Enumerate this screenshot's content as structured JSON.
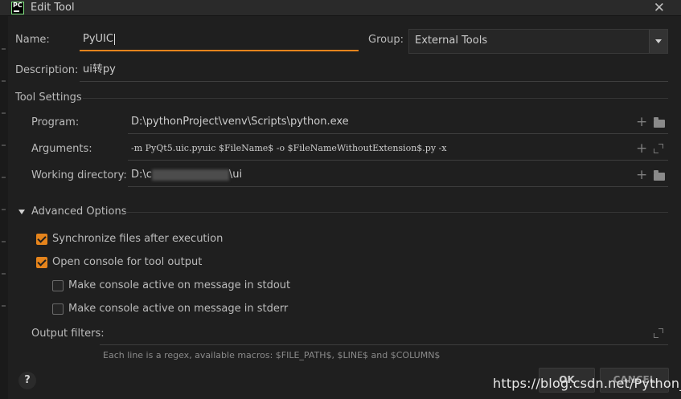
{
  "window": {
    "title": "Edit Tool",
    "app_icon_text": "PC",
    "close_glyph": "✕"
  },
  "form": {
    "name_label": "Name:",
    "name_value": "PyUIC",
    "group_label": "Group:",
    "group_value": "External Tools",
    "description_label": "Description:",
    "description_value": "ui转py"
  },
  "tool_settings": {
    "heading": "Tool Settings",
    "program_label": "Program:",
    "program_value": "D:\\pythonProject\\venv\\Scripts\\python.exe",
    "arguments_label": "Arguments:",
    "arguments_value": "-m PyQt5.uic.pyuic $FileName$ -o $FileNameWithoutExtension$.py -x",
    "working_dir_label": "Working directory:",
    "working_dir_prefix": "D:\\c",
    "working_dir_suffix": "\\ui"
  },
  "advanced": {
    "heading": "Advanced Options",
    "sync_label": "Synchronize files after execution",
    "sync_checked": true,
    "console_label": "Open console for tool output",
    "console_checked": true,
    "stdout_label": "Make console active on message in stdout",
    "stdout_checked": false,
    "stderr_label": "Make console active on message in stderr",
    "stderr_checked": false,
    "filters_label": "Output filters:",
    "filters_hint": "Each line is a regex, available macros: $FILE_PATH$, $LINE$ and $COLUMN$"
  },
  "footer": {
    "help_label": "?",
    "ok_label": "OK",
    "cancel_label": "CANCEL",
    "watermark": "https://blog.csdn.net/Python_DJ"
  },
  "icons": {
    "plus": "+",
    "folder": "folder-icon",
    "expand": "expand-icon"
  },
  "colors": {
    "accent": "#e5841c",
    "background": "#1f1f1f",
    "titlebar": "#2a2a2a"
  }
}
